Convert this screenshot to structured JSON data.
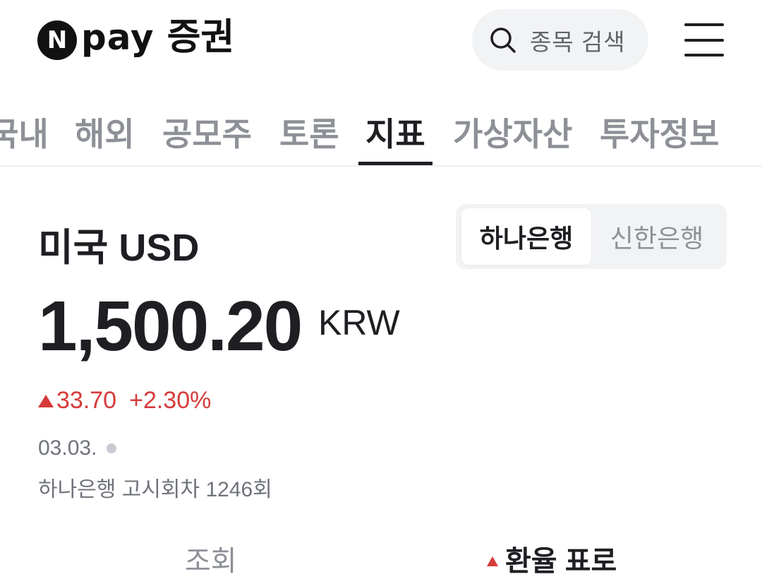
{
  "header": {
    "logo_mark": "N",
    "logo_pay": "pay",
    "logo_sub": "증권",
    "search_placeholder": "종목 검색",
    "search_icon": "search-icon",
    "menu_icon": "hamburger-menu-icon"
  },
  "tabs": [
    {
      "label": "국내",
      "active": false
    },
    {
      "label": "해외",
      "active": false
    },
    {
      "label": "공모주",
      "active": false
    },
    {
      "label": "토론",
      "active": false
    },
    {
      "label": "지표",
      "active": true
    },
    {
      "label": "가상자산",
      "active": false
    },
    {
      "label": "투자정보",
      "active": false
    }
  ],
  "currency": {
    "country_label": "미국 USD",
    "price": "1,500.20",
    "unit": "KRW",
    "change_abs": "33.70",
    "change_pct": "+2.30%",
    "change_color": "#d63a3a",
    "date": "03.03.",
    "notice": "하나은행 고시회차 1246회"
  },
  "bank_toggle": {
    "selected": "하나은행",
    "other": "신한은행"
  },
  "bottom_row": {
    "left_label": "조회",
    "right_label": "환율 표로"
  },
  "colors": {
    "accent_up": "#d63a3a",
    "text_primary": "#1e1e23",
    "text_muted": "#8d9097"
  }
}
